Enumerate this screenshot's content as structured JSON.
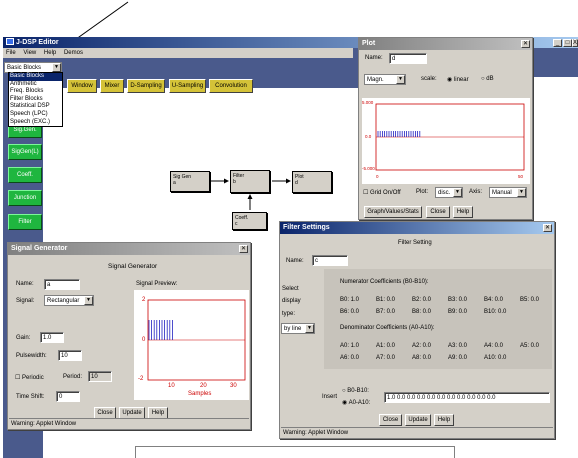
{
  "main": {
    "title": "J-DSP Editor",
    "menu": [
      "File",
      "View",
      "Help",
      "Demos"
    ],
    "window_controls": [
      "_",
      "□",
      "X"
    ],
    "block_select": "Basic Blocks",
    "dropdown_options": [
      "Basic Blocks",
      "Arithmetic",
      "Freq. Blocks",
      "Filter Blocks",
      "Statistical DSP",
      "Speech (LPC)",
      "Speech (EXC.)"
    ],
    "toolbar": [
      "Window",
      "Mixer",
      "D-Sampling",
      "U-Sampling",
      "Convolution"
    ],
    "side_buttons": [
      "Sig.Gen.",
      "SigGen(L)",
      "Coeff.",
      "Junction",
      "Filter"
    ],
    "blocks": {
      "siggen": {
        "title": "Sig Gen",
        "sub": "a"
      },
      "filter": {
        "title": "Filter",
        "sub": "b"
      },
      "plot": {
        "title": "Plot",
        "sub": "d"
      },
      "coeff": {
        "title": "Coeff.",
        "sub": "c"
      }
    }
  },
  "plot_window": {
    "title": "Plot",
    "name_label": "Name:",
    "name_value": "d",
    "mode": "Magn.",
    "scale_label": "scale:",
    "scale_options": [
      "linear",
      "dB"
    ],
    "scale_selected": "linear",
    "y_ticks": [
      "5.000",
      "0.0",
      "-5.000"
    ],
    "x_ticks": [
      "0",
      "50"
    ],
    "grid_label": "Grid On/Off",
    "plot_label": "Plot:",
    "plot_value": "disc.",
    "axis_label": "Axis:",
    "axis_value": "Manual",
    "buttons": [
      "Graph/Values/Stats",
      "Close",
      "Help"
    ],
    "stem_values": [
      0.2,
      0.2,
      0.2,
      0.2,
      0.2,
      0.2,
      0.2,
      0.2,
      0.2,
      0.2,
      0.2,
      0.2,
      0.2,
      0.2,
      0.2,
      0.2,
      0.2,
      0.2,
      0.2,
      0.2
    ]
  },
  "siggen_window": {
    "title": "Signal Generator",
    "heading": "Signal Generator",
    "name_label": "Name:",
    "name_value": "a",
    "signal_label": "Signal:",
    "signal_value": "Rectangular",
    "preview_label": "Signal Preview:",
    "gain_label": "Gain:",
    "gain_value": "1.0",
    "pulse_label": "Pulsewidth:",
    "pulse_value": "10",
    "periodic_label": "Periodic",
    "period_label": "Period:",
    "period_value": "10",
    "shift_label": "Time Shift:",
    "shift_value": "0",
    "y_ticks": [
      "2",
      "0",
      "-2"
    ],
    "x_ticks": [
      "10",
      "20",
      "30"
    ],
    "x_axis": "Samples",
    "buttons": [
      "Close",
      "Update",
      "Help"
    ],
    "status": "Warning: Applet Window",
    "stem_values": [
      1,
      1,
      1,
      1,
      1,
      1,
      1,
      1,
      1,
      1
    ]
  },
  "filter_window": {
    "title": "Filter Settings",
    "heading": "Filter Setting",
    "name_label": "Name:",
    "name_value": "c",
    "select_label": [
      "Select",
      "display",
      "type:"
    ],
    "type_value": "by line",
    "num_heading": "Numerator Coefficients (B0-B10):",
    "num_row1": [
      "B0: 1.0",
      "B1: 0.0",
      "B2: 0.0",
      "B3: 0.0",
      "B4: 0.0",
      "B5: 0.0"
    ],
    "num_row2": [
      "B6: 0.0",
      "B7: 0.0",
      "B8: 0.0",
      "B9: 0.0",
      "B10: 0.0"
    ],
    "den_heading": "Denominator Coefficients (A0-A10):",
    "den_row1": [
      "A0: 1.0",
      "A1: 0.0",
      "A2: 0.0",
      "A3: 0.0",
      "A4: 0.0",
      "A5: 0.0"
    ],
    "den_row2": [
      "A6: 0.0",
      "A7: 0.0",
      "A8: 0.0",
      "A9: 0.0",
      "A10: 0.0"
    ],
    "insert_label": "Insert",
    "insert_options": [
      "B0-B10:",
      "A0-A10:"
    ],
    "insert_selected": "A0-A10:",
    "insert_value": "1.0  0.0  0.0  0.0  0.0  0.0  0.0  0.0  0.0  0.0  0.0",
    "buttons": [
      "Close",
      "Update",
      "Help"
    ],
    "status": "Warning: Applet Window"
  },
  "colors": {
    "titlebar": "#0a246a",
    "yellow_button": "#d4c238",
    "green_button": "#1fb63f",
    "plot_red": "#cc0000",
    "stem_blue": "#2020c0"
  }
}
